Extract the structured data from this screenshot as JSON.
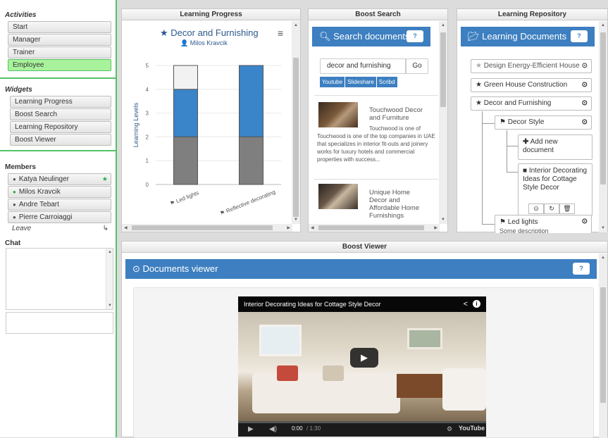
{
  "sidebar": {
    "activities_title": "Activities",
    "activities": [
      {
        "label": "Start",
        "active": false
      },
      {
        "label": "Manager",
        "active": false
      },
      {
        "label": "Trainer",
        "active": false
      },
      {
        "label": "Employee",
        "active": true
      }
    ],
    "widgets_title": "Widgets",
    "widgets": [
      "Learning Progress",
      "Boost Search",
      "Learning Repository",
      "Boost Viewer"
    ],
    "members_title": "Members",
    "members": [
      {
        "name": "Katya Neulinger",
        "online": false,
        "starred": true
      },
      {
        "name": "Milos Kravcik",
        "online": true,
        "starred": false
      },
      {
        "name": "Andre Tebart",
        "online": false,
        "starred": false
      },
      {
        "name": "Pierre Carroiaggi",
        "online": false,
        "starred": false
      }
    ],
    "leave_label": "Leave",
    "leave_icon": "↳",
    "chat_title": "Chat"
  },
  "learning_progress": {
    "panel_title": "Learning Progress",
    "title": "Decor and Furnishing",
    "user": "Milos Kravcik",
    "chart_data": {
      "type": "bar",
      "stacked": true,
      "ylabel": "Learning Levels",
      "ylim": [
        0,
        5
      ],
      "yticks": [
        0,
        1,
        2,
        3,
        4,
        5
      ],
      "categories": [
        "Led lights",
        "Reflective decorating"
      ],
      "series": [
        {
          "color": "#7f7f7f",
          "values": [
            2,
            2
          ]
        },
        {
          "color": "#3a84c9",
          "values": [
            2,
            3
          ]
        },
        {
          "color": "#f2f2f2",
          "values": [
            1,
            0
          ]
        }
      ]
    }
  },
  "boost_search": {
    "panel_title": "Boost Search",
    "header": "Search documents",
    "query": "decor and furnishing",
    "go_label": "Go",
    "sources": [
      "Youtube",
      "Slideshare",
      "Scribd"
    ],
    "results": [
      {
        "title": "Touchwood Decor and Furniture",
        "desc": "Touchwood is one of the top companies in UAE that specializes in interior fit-outs and joinery works for luxury hotels and commercial properties with success..."
      },
      {
        "title": "Unique Home Decor and Affordable Home Furnishings",
        "desc": ""
      }
    ]
  },
  "learning_repository": {
    "panel_title": "Learning Repository",
    "header": "Learning Documents",
    "items": [
      {
        "label": "Design Energy-Efficient House",
        "starred": false
      },
      {
        "label": "Green House Construction",
        "starred": true
      },
      {
        "label": "Decor and Furnishing",
        "starred": true
      }
    ],
    "sub_item": "Decor Style",
    "add_label": "Add new document",
    "doc_label": "Interior Decorating Ideas for Cottage Style Decor",
    "led_label": "Led lights",
    "led_desc": "Some description"
  },
  "boost_viewer": {
    "panel_title": "Boost Viewer",
    "header": "Documents viewer",
    "video_title": "Interior Decorating Ideas for Cottage Style Decor",
    "time": "0:00",
    "duration": "/ 1:30",
    "brand": "YouTube"
  }
}
